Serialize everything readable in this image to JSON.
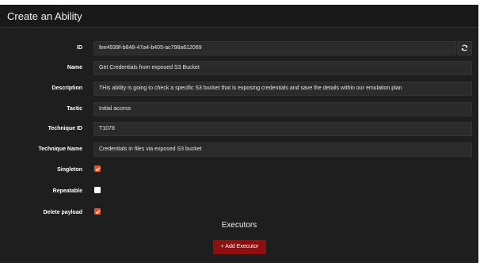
{
  "modal": {
    "title": "Create an Ability"
  },
  "fields": {
    "id": {
      "label": "ID",
      "value": "fee4939f-b848-47a4-b405-ac798a612069"
    },
    "name": {
      "label": "Name",
      "value": "Get Credentials from exposed S3 Bucket"
    },
    "description": {
      "label": "Description",
      "value": "THis ability is going to check a specific S3 bucket that is exposing credentials and save the details within our emulation plan"
    },
    "tactic": {
      "label": "Tactic",
      "value": "Initial access"
    },
    "technique_id": {
      "label": "Technique ID",
      "value": "T1078"
    },
    "technique_name": {
      "label": "Technique Name",
      "value": "Credentials in files via exposed S3 bucket"
    }
  },
  "checkboxes": {
    "singleton": {
      "label": "Singleton",
      "checked": true
    },
    "repeatable": {
      "label": "Repeatable",
      "checked": false
    },
    "delete_payload": {
      "label": "Delete payload",
      "checked": true
    }
  },
  "executors": {
    "title": "Executors",
    "add_label": "+ Add Executor"
  },
  "icons": {
    "regenerate": "refresh-icon",
    "check": "checkmark-icon"
  },
  "colors": {
    "accent": "#e2541e",
    "button": "#8f0f0f"
  }
}
